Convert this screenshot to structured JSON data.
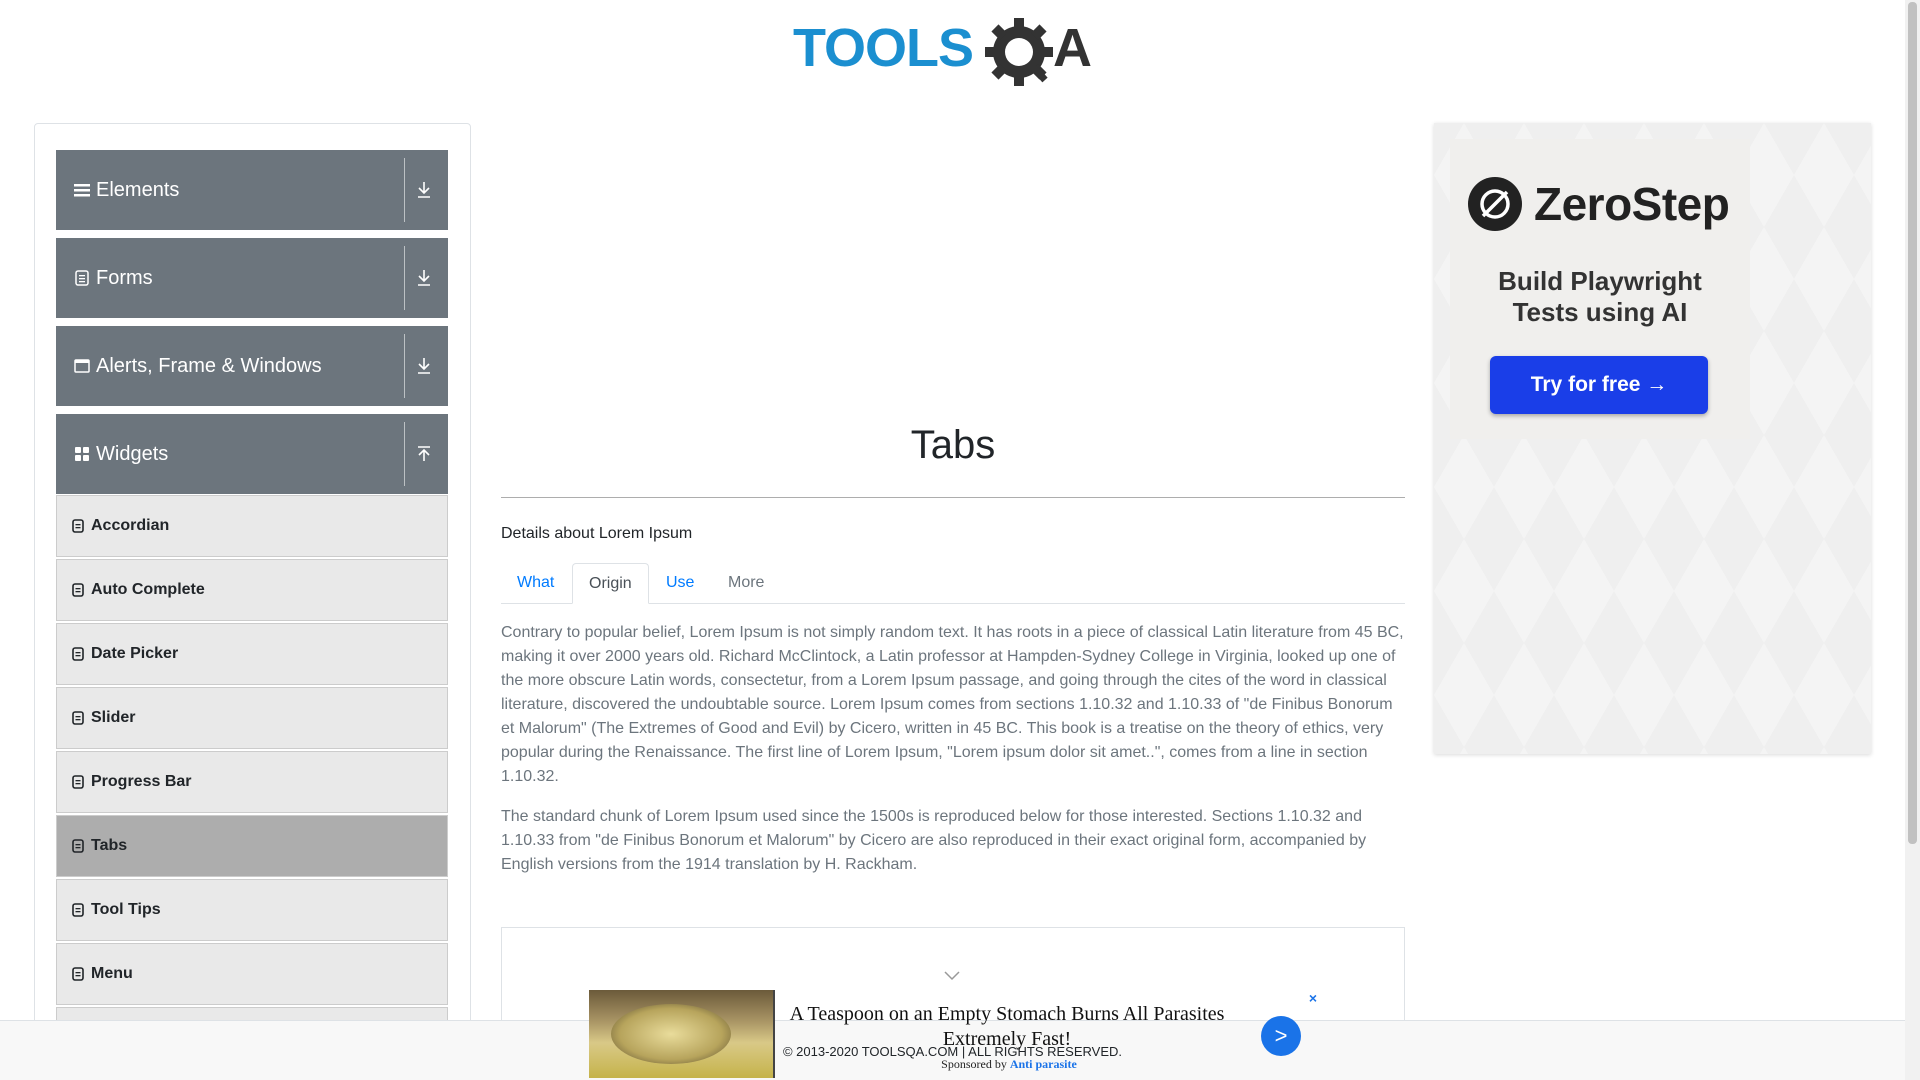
{
  "header": {
    "logo_text": "TOOLSQA"
  },
  "sidebar": {
    "groups": [
      {
        "label": "Elements",
        "icon": "hamburger-icon",
        "expanded": false
      },
      {
        "label": "Forms",
        "icon": "document-icon",
        "expanded": false
      },
      {
        "label": "Alerts, Frame & Windows",
        "icon": "window-icon",
        "expanded": false
      },
      {
        "label": "Widgets",
        "icon": "grid-icon",
        "expanded": true
      }
    ],
    "items": [
      {
        "label": "Accordian"
      },
      {
        "label": "Auto Complete"
      },
      {
        "label": "Date Picker"
      },
      {
        "label": "Slider"
      },
      {
        "label": "Progress Bar"
      },
      {
        "label": "Tabs",
        "active": true
      },
      {
        "label": "Tool Tips"
      },
      {
        "label": "Menu"
      }
    ]
  },
  "main": {
    "title": "Tabs",
    "subtitle": "Details about Lorem Ipsum",
    "tabs": [
      {
        "label": "What"
      },
      {
        "label": "Origin",
        "active": true
      },
      {
        "label": "Use"
      },
      {
        "label": "More",
        "disabled": true
      }
    ],
    "paragraphs": [
      "Contrary to popular belief, Lorem Ipsum is not simply random text. It has roots in a piece of classical Latin literature from 45 BC, making it over 2000 years old. Richard McClintock, a Latin professor at Hampden-Sydney College in Virginia, looked up one of the more obscure Latin words, consectetur, from a Lorem Ipsum passage, and going through the cites of the word in classical literature, discovered the undoubtable source. Lorem Ipsum comes from sections 1.10.32 and 1.10.33 of \"de Finibus Bonorum et Malorum\" (The Extremes of Good and Evil) by Cicero, written in 45 BC. This book is a treatise on the theory of ethics, very popular during the Renaissance. The first line of Lorem Ipsum, \"Lorem ipsum dolor sit amet..\", comes from a line in section 1.10.32.",
      "The standard chunk of Lorem Ipsum used since the 1500s is reproduced below for those interested. Sections 1.10.32 and 1.10.33 from \"de Finibus Bonorum et Malorum\" by Cicero are also reproduced in their exact original form, accompanied by English versions from the 1914 translation by H. Rackham."
    ]
  },
  "right_ad": {
    "brand": "ZeroStep",
    "tagline_line1": "Build Playwright",
    "tagline_line2": "Tests using AI",
    "cta": "Try for free →"
  },
  "bottom_ad": {
    "headline": "A Teaspoon on an Empty Stomach Burns All Parasites Extremely Fast!",
    "sponsored_prefix": "Sponsored by",
    "sponsor": "Anti parasite",
    "close": "×",
    "go": ">"
  },
  "footer": {
    "text": "© 2013-2020 TOOLSQA.COM | ALL RIGHTS RESERVED."
  },
  "colors": {
    "group_bg": "#6c757d",
    "item_bg": "#e9e9e9",
    "item_active_bg": "#adadad",
    "link": "#007bff",
    "zerostep_button": "#1a3ee8"
  }
}
